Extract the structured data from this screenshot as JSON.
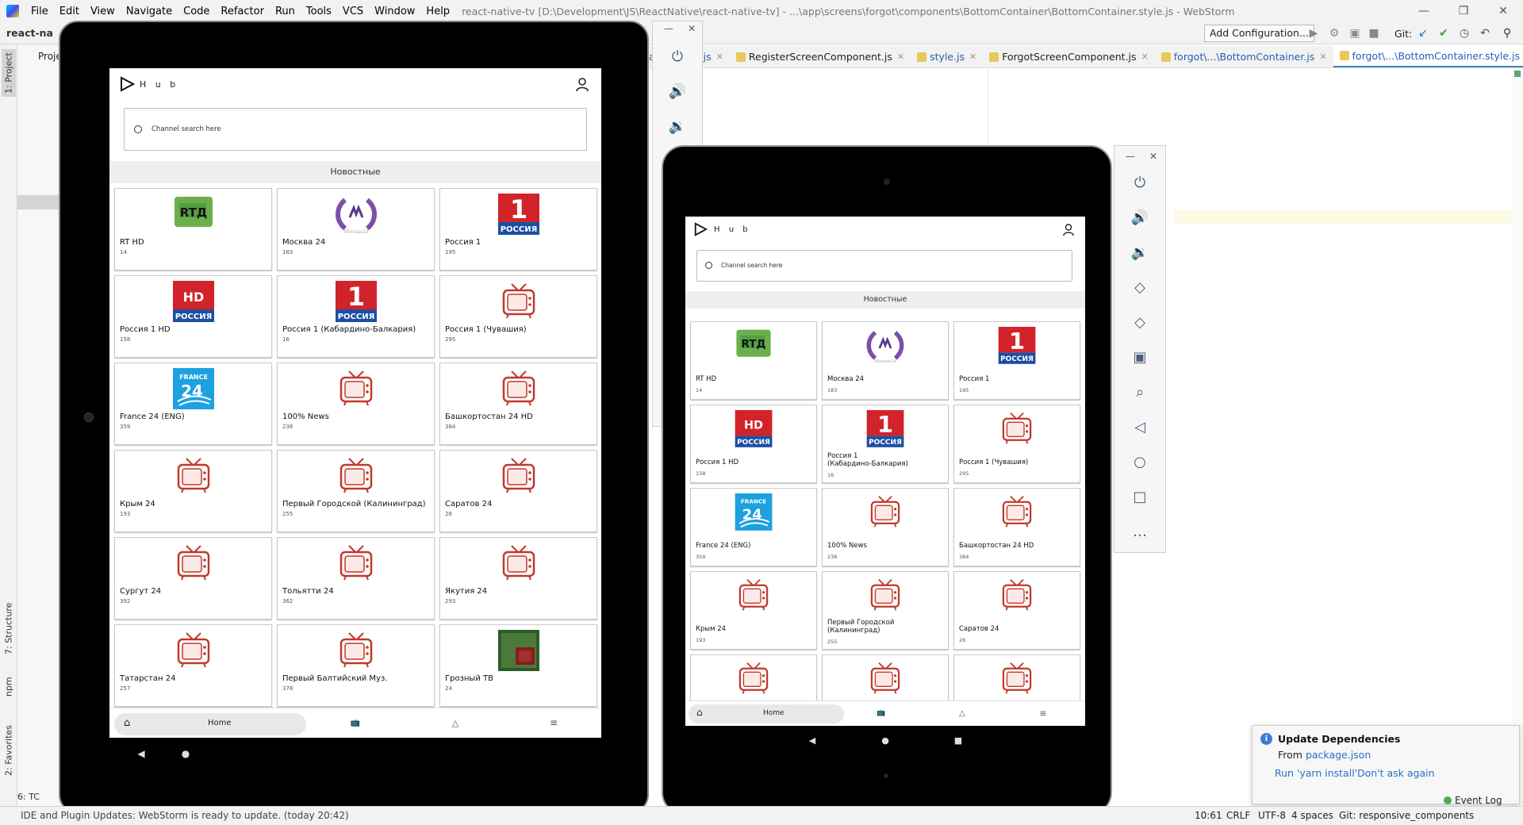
{
  "ide": {
    "menu": [
      "File",
      "Edit",
      "View",
      "Navigate",
      "Code",
      "Refactor",
      "Run",
      "Tools",
      "VCS",
      "Window",
      "Help"
    ],
    "window_title": "react-native-tv [D:\\Development\\JS\\ReactNative\\react-native-tv] - ...\\app\\screens\\forgot\\components\\BottomContainer\\BottomContainer.style.js - WebStorm",
    "project_name": "react-na",
    "project_tab": "Proje",
    "add_configuration": "Add Configuration...",
    "git_label": "Git:",
    "left_tabs": [
      "1: Project",
      "7: Structure",
      "npm",
      "2: Favorites"
    ],
    "bottom_tool": "6: TC",
    "editor_tabs": [
      {
        "label": "ainer.style.js",
        "blue": true
      },
      {
        "label": "RegisterScreenComponent.js",
        "blue": false
      },
      {
        "label": "style.js",
        "blue": true
      },
      {
        "label": "ForgotScreenComponent.js",
        "blue": false
      },
      {
        "label": "forgot\\...\\BottomContainer.js",
        "blue": true
      },
      {
        "label": "forgot\\...\\BottomContainer.style.js",
        "blue": true,
        "active": true
      }
    ],
    "status_message": "IDE and Plugin Updates: WebStorm is ready to update. (today 20:42)",
    "status_items": {
      "position": "10:61",
      "line_sep": "CRLF",
      "encoding": "UTF-8",
      "indent": "4 spaces",
      "git": "Git: responsive_components"
    },
    "event_log": "Event Log",
    "notification": {
      "title": "Update Dependencies",
      "body_prefix": "From ",
      "body_link": "package.json",
      "action1": "Run 'yarn install'",
      "action2": "Don't ask again"
    }
  },
  "app": {
    "logo_text": "H u b",
    "search_placeholder": "Channel search here",
    "category": "Новостные",
    "home_label": "Home",
    "channels": [
      {
        "name": "RT HD",
        "num": "14",
        "logo": "rt"
      },
      {
        "name": "Москва 24",
        "num": "183",
        "logo": "m24"
      },
      {
        "name": "Россия 1",
        "num": "195",
        "logo": "r1"
      },
      {
        "name": "Россия 1 HD",
        "num": "158",
        "logo": "r1hd"
      },
      {
        "name": "Россия 1 (Кабардино-Балкария)",
        "num": "16",
        "logo": "r1"
      },
      {
        "name": "Россия 1 (Чувашия)",
        "num": "295",
        "logo": "tv"
      },
      {
        "name": "France 24 (ENG)",
        "num": "359",
        "logo": "f24"
      },
      {
        "name": "100% News",
        "num": "236",
        "logo": "tv"
      },
      {
        "name": "Башкортостан 24 HD",
        "num": "384",
        "logo": "tv"
      },
      {
        "name": "Крым 24",
        "num": "193",
        "logo": "tv"
      },
      {
        "name": "Первый Городской (Калининград)",
        "num": "255",
        "logo": "tv"
      },
      {
        "name": "Саратов 24",
        "num": "26",
        "logo": "tv"
      },
      {
        "name": "Сургут 24",
        "num": "392",
        "logo": "tv"
      },
      {
        "name": "Тольятти 24",
        "num": "362",
        "logo": "tv"
      },
      {
        "name": "Якутия 24",
        "num": "293",
        "logo": "tv"
      },
      {
        "name": "Татарстан 24",
        "num": "257",
        "logo": "tv"
      },
      {
        "name": "Первый Балтийский Муз.",
        "num": "378",
        "logo": "tv"
      },
      {
        "name": "Грозный ТВ",
        "num": "24",
        "logo": "grozny"
      }
    ],
    "tablet2_names": [
      "RT HD",
      "Москва 24",
      "Россия 1",
      "Россия 1 HD",
      "Россия 1\n(Кабардино-Балкария)",
      "Россия 1 (Чувашия)",
      "France 24 (ENG)",
      "100% News",
      "Башкортостан 24 HD",
      "Крым 24",
      "Первый Городской\n(Калининград)",
      "Саратов 24"
    ]
  },
  "emulator_tools": [
    "power-icon",
    "volume-up-icon",
    "volume-down-icon",
    "rotate-left-icon",
    "rotate-right-icon",
    "camera-icon",
    "zoom-icon",
    "back-icon",
    "home-icon",
    "overview-icon",
    "more-icon"
  ],
  "colors": {
    "accent": "#4083c9",
    "link": "#2a6ec9",
    "russia_red": "#d2232a",
    "russia_blue": "#1c4fa3",
    "rt_green": "#6ab04c",
    "m24_purple": "#7a4fa8",
    "f24_blue": "#1da1e0",
    "tv_red": "#c0392b"
  }
}
